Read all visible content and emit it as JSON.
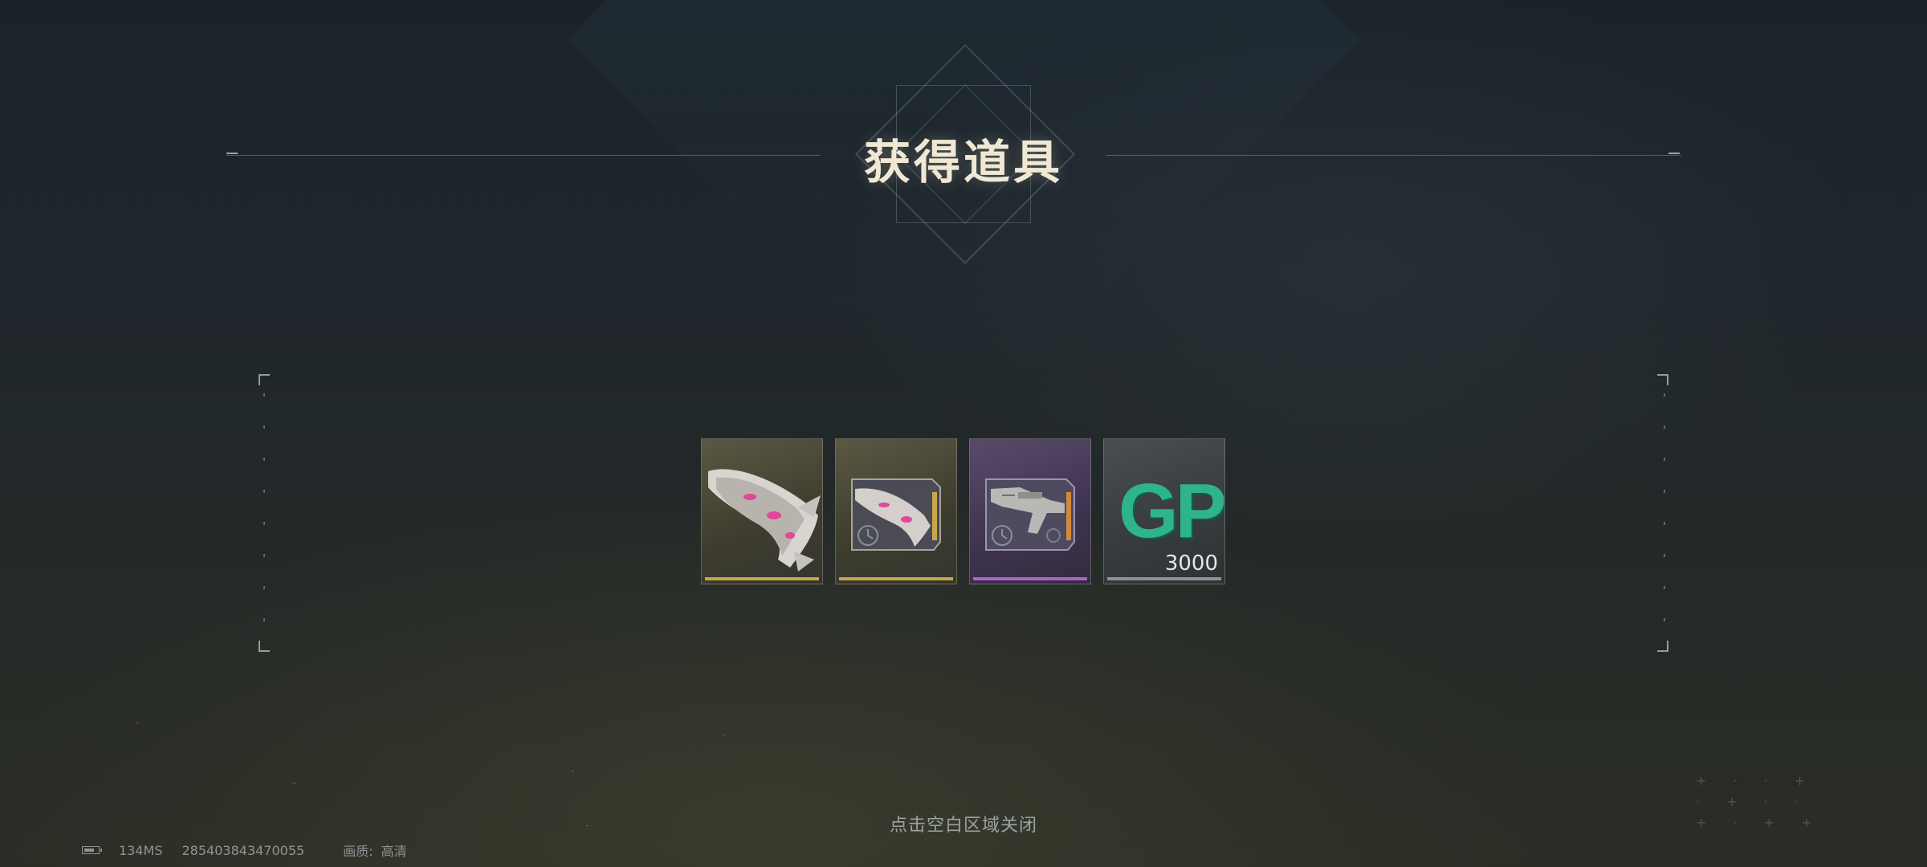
{
  "dialog": {
    "title": "获得道具",
    "close_hint": "点击空白区域关闭"
  },
  "items": [
    {
      "name": "weapon-skin-item",
      "rarity": "gold",
      "rarity_color": "#c9a64a",
      "icon": "pink-claw-weapon-icon"
    },
    {
      "name": "weapon-trial-card-item",
      "rarity": "gold",
      "rarity_color": "#c9a64a",
      "icon": "pink-claw-weapon-card-icon"
    },
    {
      "name": "rifle-trial-card-item",
      "rarity": "purple",
      "rarity_color": "#b360d0",
      "icon": "rifle-card-icon"
    },
    {
      "name": "gp-currency-item",
      "rarity": "grey",
      "rarity_color": "#8d9296",
      "icon": "gp-icon",
      "label": "GP",
      "quantity": "3000"
    }
  ],
  "status_bar": {
    "ping": "134MS",
    "uid": "285403843470055",
    "quality_label": "画质:",
    "quality_value": "高清"
  }
}
